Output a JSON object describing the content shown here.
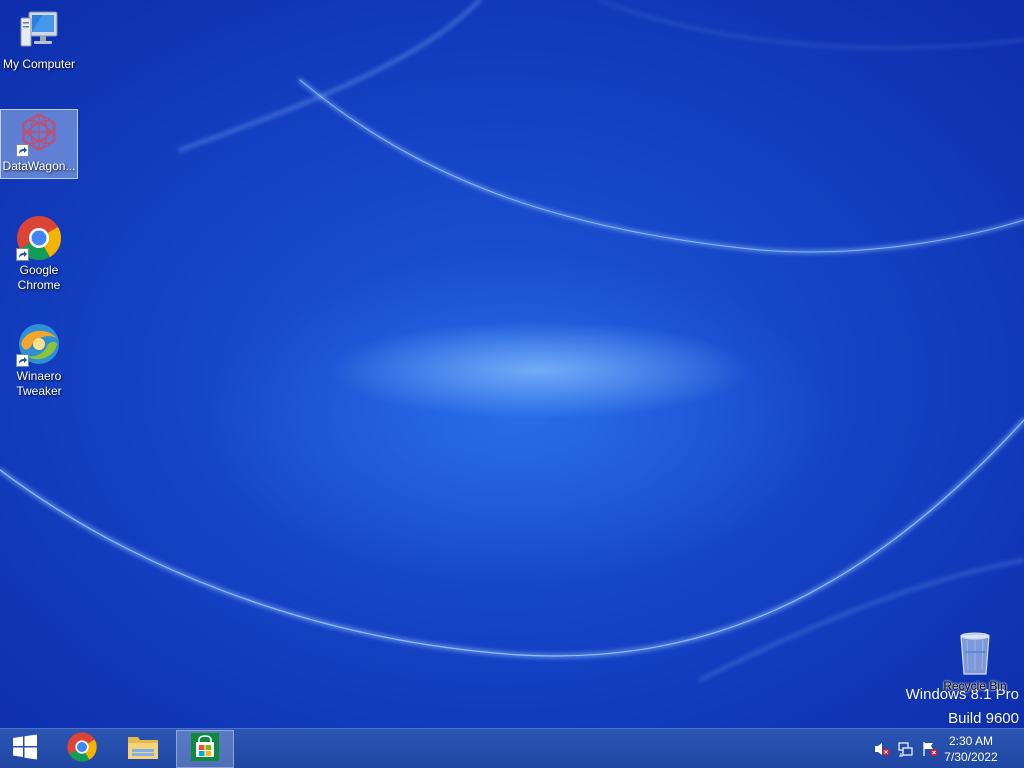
{
  "desktop": {
    "icons": [
      {
        "label": "My Computer",
        "icon": "computer-icon"
      },
      {
        "label": "DataWagon...",
        "icon": "datawagon-icon",
        "selected": true
      },
      {
        "label": "Google Chrome",
        "icon": "chrome-icon"
      },
      {
        "label": "Winaero Tweaker",
        "icon": "winaero-icon"
      }
    ],
    "recycle_bin": {
      "label": "Recycle Bin",
      "icon": "recycle-bin-icon"
    },
    "watermark": {
      "line1": "Windows 8.1 Pro",
      "line2": "Build 9600"
    }
  },
  "taskbar": {
    "start": {
      "icon": "windows-logo-icon"
    },
    "pinned": [
      {
        "name": "Google Chrome",
        "icon": "chrome-icon"
      },
      {
        "name": "File Explorer",
        "icon": "folder-icon"
      },
      {
        "name": "Store",
        "icon": "store-icon",
        "active": true
      }
    ],
    "tray": [
      {
        "name": "volume-muted-icon"
      },
      {
        "name": "network-icon"
      },
      {
        "name": "action-center-flag-icon"
      }
    ],
    "clock": {
      "time": "2:30 AM",
      "date": "7/30/2022"
    }
  },
  "colors": {
    "accent": "#1e4aa8",
    "desktop": "#1441c4"
  }
}
